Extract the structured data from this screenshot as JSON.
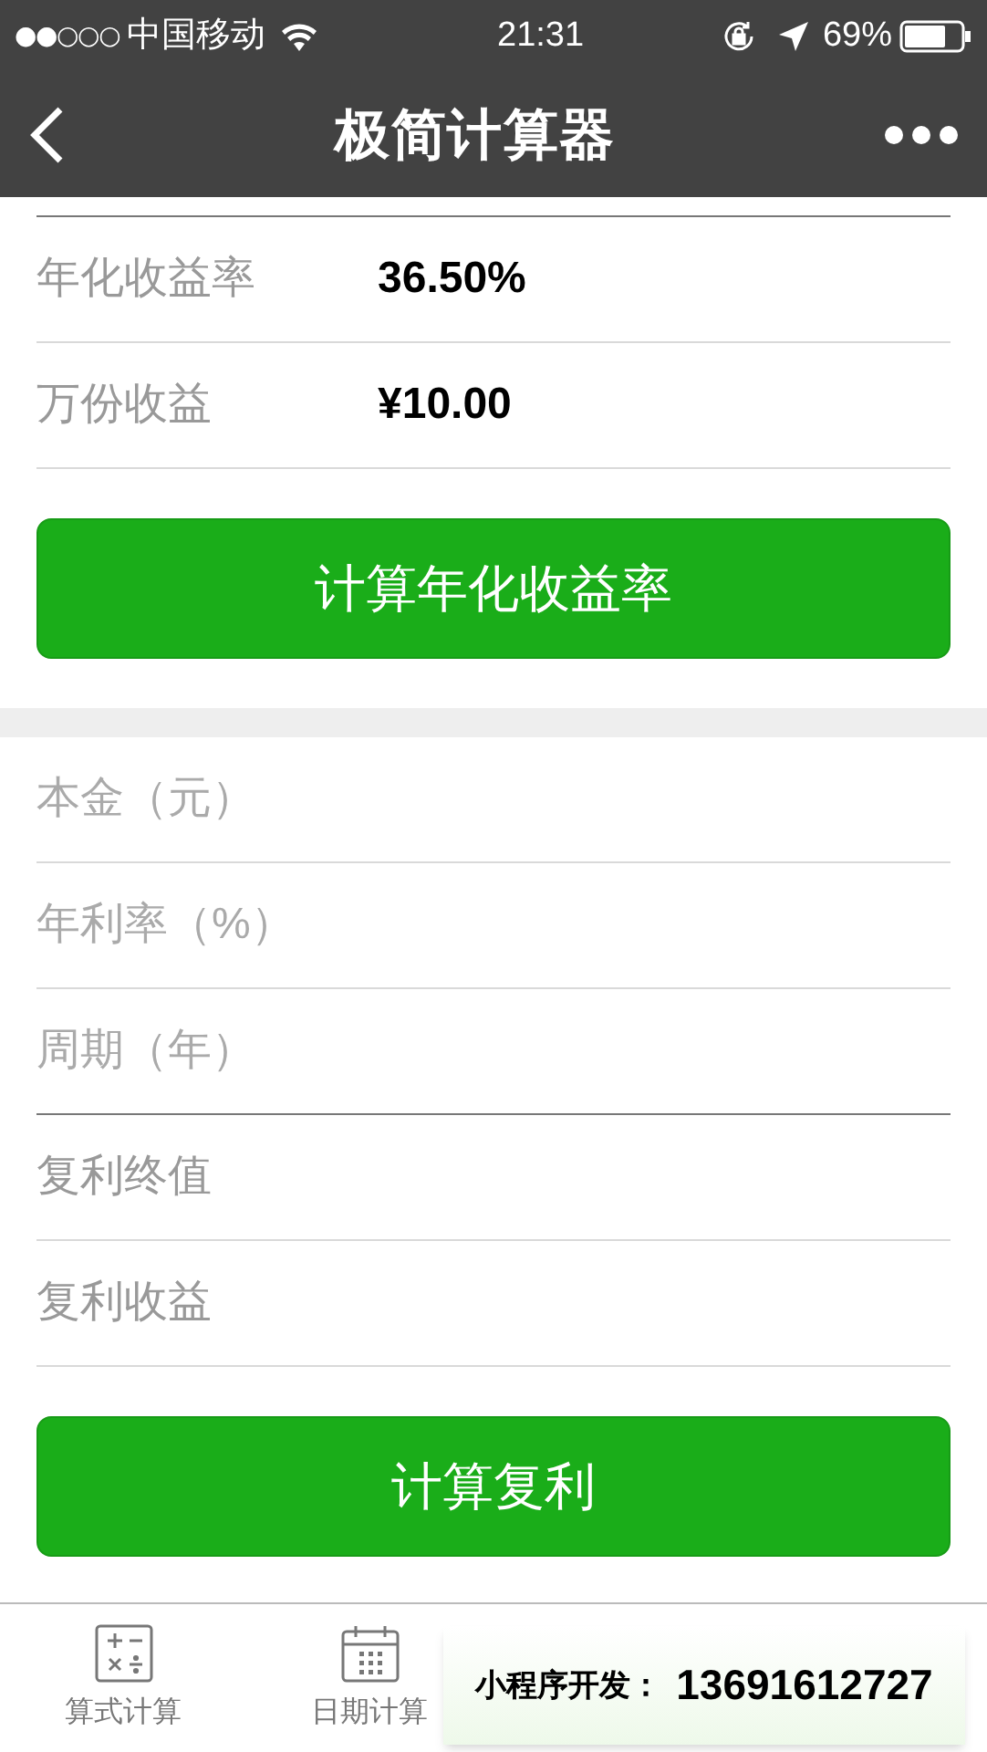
{
  "status_bar": {
    "signal": "●●○○○",
    "carrier": "中国移动",
    "time": "21:31",
    "battery": "69%"
  },
  "nav": {
    "title": "极简计算器"
  },
  "annual_section": {
    "rows": [
      {
        "label": "年化收益率",
        "value": "36.50%"
      },
      {
        "label": "万份收益",
        "value": "¥10.00"
      }
    ],
    "button": "计算年化收益率"
  },
  "compound_section": {
    "fields": [
      {
        "kind": "input",
        "placeholder": "本金（元）"
      },
      {
        "kind": "input",
        "placeholder": "年利率（%）"
      },
      {
        "kind": "input",
        "placeholder": "周期（年）"
      },
      {
        "kind": "result",
        "label": "复利终值"
      },
      {
        "kind": "result",
        "label": "复利收益"
      }
    ],
    "button": "计算复利"
  },
  "tab_bar": [
    {
      "label": "算式计算",
      "kind": "calculator",
      "selected": false
    },
    {
      "label": "日期计算",
      "kind": "calendar",
      "selected": false
    }
  ],
  "overlay": {
    "text": "小程序开发：",
    "phone": "13691612727"
  }
}
